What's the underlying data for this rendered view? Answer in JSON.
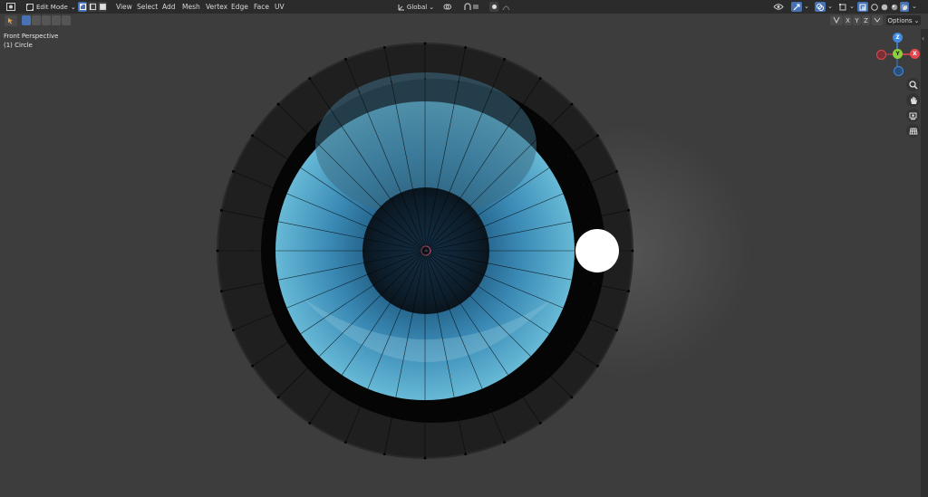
{
  "header": {
    "mode_label": "Edit Mode",
    "menus": [
      "View",
      "Select",
      "Add",
      "Mesh",
      "Vertex",
      "Edge",
      "Face",
      "UV"
    ],
    "transform_orientation": "Global"
  },
  "toolbar2": {
    "axes": [
      "X",
      "Y",
      "Z"
    ],
    "options_label": "Options"
  },
  "viewport": {
    "view_name": "Front Perspective",
    "object_name": "(1) Circle"
  },
  "gizmo": {
    "x_label": "X",
    "y_label": "Y",
    "z_label": "Z",
    "colors": {
      "x": "#e8464f",
      "y": "#8bd03b",
      "z": "#3f8ae0"
    }
  },
  "icons": [
    "editor-type-icon",
    "vertex-select-icon",
    "edge-select-icon",
    "face-select-icon",
    "snap-icon",
    "proportional-icon",
    "zoom-icon",
    "hand-icon",
    "camera-icon",
    "grid-icon",
    "overlay-icon",
    "xray-icon",
    "shading-icon"
  ]
}
